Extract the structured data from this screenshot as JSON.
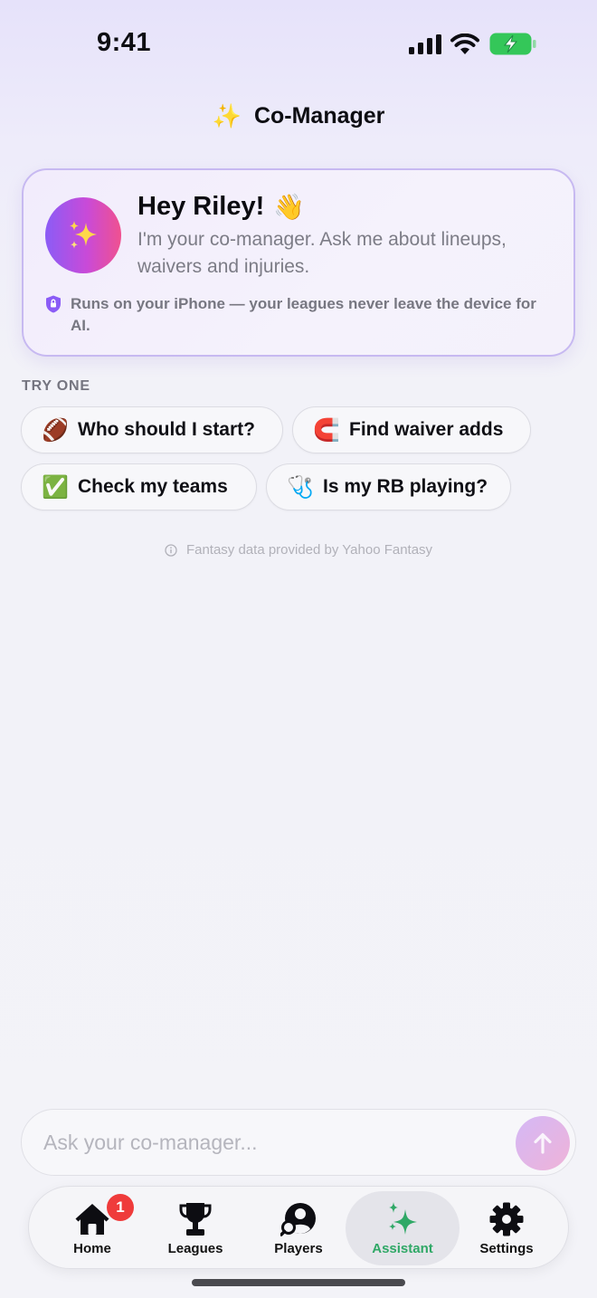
{
  "status_bar": {
    "time": "9:41"
  },
  "header": {
    "sparkle": "✨",
    "title": "Co-Manager"
  },
  "welcome": {
    "title": "Hey Riley!",
    "wave": "👋",
    "body": "I'm your co-manager. Ask me about lineups, waivers and injuries.",
    "privacy_note": "Runs on your iPhone — your leagues never leave the device for AI."
  },
  "suggestions": {
    "label": "TRY ONE",
    "chips": [
      {
        "emoji": "🏈",
        "label": "Who should I start?"
      },
      {
        "emoji": "🧲",
        "label": "Find waiver adds"
      },
      {
        "emoji": "✅",
        "label": "Check my teams"
      },
      {
        "emoji": "🩺",
        "label": "Is my RB playing?"
      }
    ]
  },
  "attribution": "Fantasy data provided by Yahoo Fantasy",
  "composer": {
    "placeholder": "Ask your co-manager..."
  },
  "tab_bar": {
    "tabs": [
      {
        "label": "Home",
        "icon": "house-icon",
        "badge": "1"
      },
      {
        "label": "Leagues",
        "icon": "trophy-icon"
      },
      {
        "label": "Players",
        "icon": "player-search-icon"
      },
      {
        "label": "Assistant",
        "icon": "sparkles-icon",
        "selected": true
      },
      {
        "label": "Settings",
        "icon": "gear-icon"
      }
    ]
  },
  "colors": {
    "accent_purple": "#8b5cf6",
    "accent_pink": "#f0518f",
    "assistant_green": "#2fa866",
    "badge_red": "#ef3b3b",
    "battery_green": "#34c759"
  }
}
